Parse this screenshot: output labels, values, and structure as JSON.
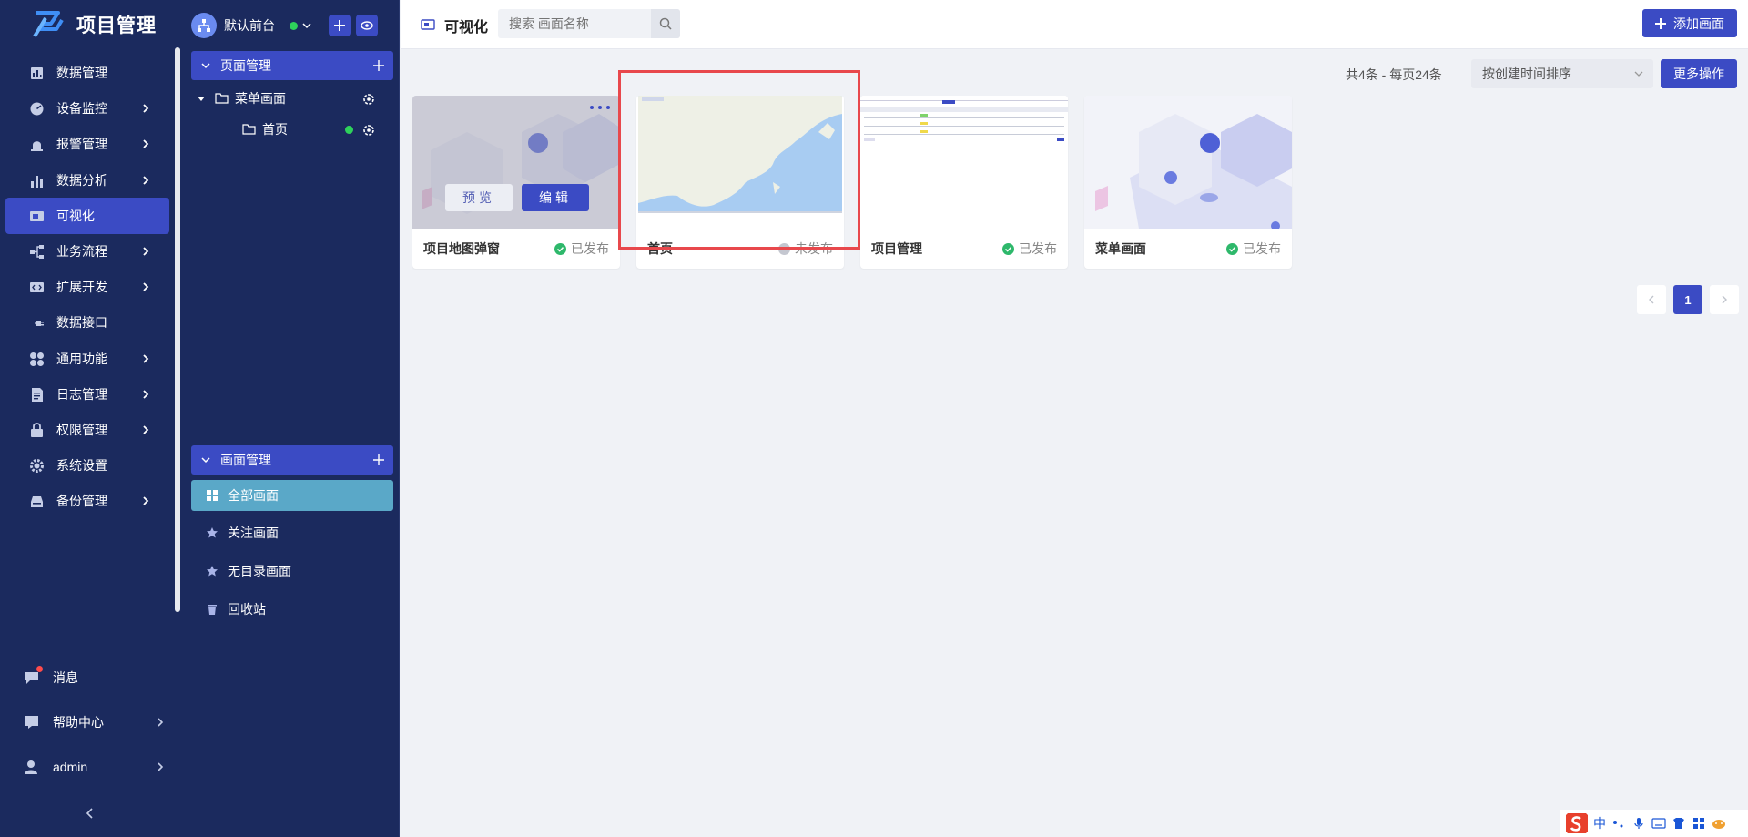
{
  "app": {
    "title": "项目管理"
  },
  "nav": {
    "items": [
      {
        "label": "数据管理",
        "icon": "database-icon",
        "has_children": false
      },
      {
        "label": "设备监控",
        "icon": "monitor-icon",
        "has_children": true
      },
      {
        "label": "报警管理",
        "icon": "alarm-icon",
        "has_children": true
      },
      {
        "label": "数据分析",
        "icon": "bar-chart-icon",
        "has_children": true
      },
      {
        "label": "可视化",
        "icon": "screen-icon",
        "has_children": false,
        "active": true
      },
      {
        "label": "业务流程",
        "icon": "flow-icon",
        "has_children": true
      },
      {
        "label": "扩展开发",
        "icon": "code-icon",
        "has_children": true
      },
      {
        "label": "数据接口",
        "icon": "plug-icon",
        "has_children": false
      },
      {
        "label": "通用功能",
        "icon": "apps-icon",
        "has_children": true
      },
      {
        "label": "日志管理",
        "icon": "log-icon",
        "has_children": true
      },
      {
        "label": "权限管理",
        "icon": "lock-icon",
        "has_children": true
      },
      {
        "label": "系统设置",
        "icon": "gear-icon",
        "has_children": false
      },
      {
        "label": "备份管理",
        "icon": "backup-icon",
        "has_children": true
      }
    ],
    "bottom": {
      "messages": "消息",
      "help": "帮助中心",
      "user": "admin"
    }
  },
  "panel": {
    "workspace": "默认前台",
    "page_section": {
      "title": "页面管理",
      "folder": "菜单画面",
      "child": "首页"
    },
    "screen_section": {
      "title": "画面管理",
      "items": [
        "全部画面",
        "关注画面",
        "无目录画面",
        "回收站"
      ]
    }
  },
  "main": {
    "title": "可视化",
    "search_placeholder": "搜索 画面名称",
    "add_button": "添加画面",
    "summary": "共4条 - 每页24条",
    "sort_value": "按创建时间排序",
    "more_button": "更多操作",
    "preview_button": "预览",
    "edit_button": "编辑",
    "cards": [
      {
        "title": "项目地图弹窗",
        "status": "已发布",
        "published": true
      },
      {
        "title": "首页",
        "status": "未发布",
        "published": false
      },
      {
        "title": "项目管理",
        "status": "已发布",
        "published": true
      },
      {
        "title": "菜单画面",
        "status": "已发布",
        "published": true
      }
    ],
    "current_page": "1"
  },
  "ime": {
    "mode": "中"
  },
  "colors": {
    "nav_bg": "#1b2a5e",
    "accent": "#3b4bc4",
    "selected": "#5aa8c8",
    "published": "#2eb86b",
    "highlight_frame": "#e8484c"
  }
}
